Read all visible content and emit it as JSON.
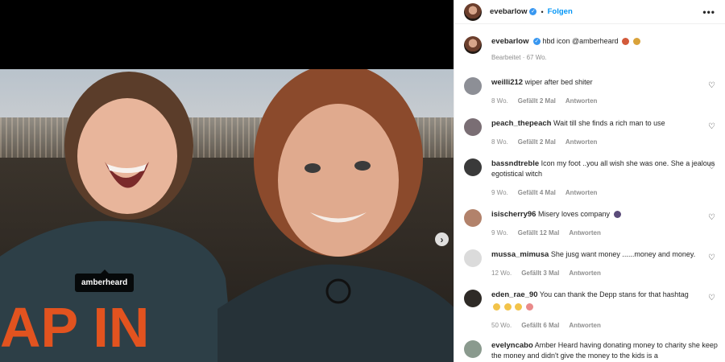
{
  "post": {
    "tag_label": "amberheard"
  },
  "header": {
    "username": "evebarlow",
    "follow_label": "Folgen",
    "more_label": "•••"
  },
  "caption": {
    "username": "evebarlow",
    "text": "hbd icon @amberheard",
    "edited": "Bearbeitet · 67 Wo."
  },
  "comments": [
    {
      "user": "weilli212",
      "text": "wiper after bed shiter",
      "time": "8 Wo.",
      "likes": "Gefällt 2 Mal",
      "reply": "Antworten",
      "avatar": "#8d8f96"
    },
    {
      "user": "peach_thepeach",
      "text": "Wait till she finds a rich man to use",
      "time": "8 Wo.",
      "likes": "Gefällt 2 Mal",
      "reply": "Antworten",
      "avatar": "#7a6e74"
    },
    {
      "user": "bassndtreble",
      "text": "Icon my foot ..you all wish she was one. She a jealous egotistical witch",
      "time": "9 Wo.",
      "likes": "Gefällt 4 Mal",
      "reply": "Antworten",
      "avatar": "#3a3a3a"
    },
    {
      "user": "isischerry96",
      "text": "Misery loves company",
      "time": "9 Wo.",
      "likes": "Gefällt 12 Mal",
      "reply": "Antworten",
      "avatar": "#b2826b"
    },
    {
      "user": "mussa_mimusa",
      "text": "She jusg want money ......money and money.",
      "time": "12 Wo.",
      "likes": "Gefällt 3 Mal",
      "reply": "Antworten",
      "avatar": "#dbdbdb"
    },
    {
      "user": "eden_rae_90",
      "text": "You can thank the Depp stans for that hashtag",
      "time": "50 Wo.",
      "likes": "Gefällt 6 Mal",
      "reply": "Antworten",
      "avatar": "#2e2a26"
    },
    {
      "user": "evelyncabo",
      "text": "Amber Heard having donating money to charity she keep the money and didn't give the money to the kids is a",
      "time": "",
      "likes": "",
      "reply": "",
      "avatar": "#8a9a8e"
    }
  ],
  "colors": {
    "accent": "#0095f6",
    "verified": "#3897f0",
    "muted": "#8e8e8e"
  }
}
